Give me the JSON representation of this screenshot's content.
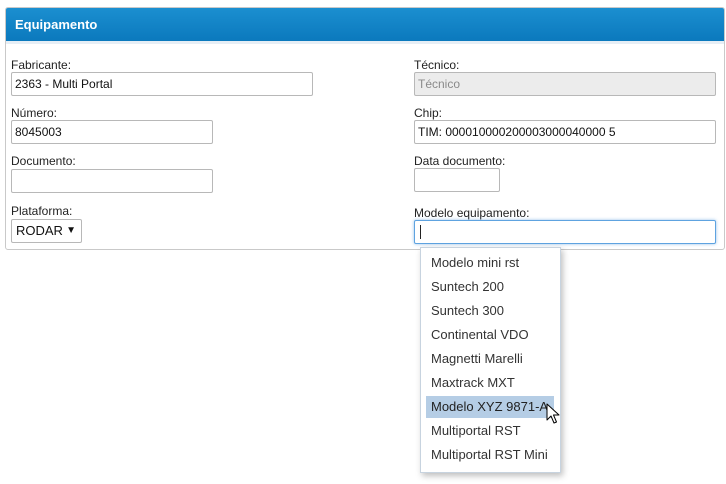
{
  "panel": {
    "title": "Equipamento"
  },
  "fields": {
    "fabricante": {
      "label": "Fabricante:",
      "value": "2363 - Multi Portal"
    },
    "numero": {
      "label": "Número:",
      "value": "8045003"
    },
    "documento": {
      "label": "Documento:",
      "value": ""
    },
    "plataforma": {
      "label": "Plataforma:",
      "value": "RODAR"
    },
    "tecnico": {
      "label": "Técnico:",
      "placeholder": "Técnico"
    },
    "chip": {
      "label": "Chip:",
      "value": "TIM: 000010000200003000040000 5"
    },
    "data_documento": {
      "label": "Data documento:",
      "value": ""
    },
    "modelo_equipamento": {
      "label": "Modelo equipamento:",
      "value": ""
    }
  },
  "dropdown": {
    "options": [
      "Modelo mini rst",
      "Suntech 200",
      "Suntech 300",
      "Continental VDO",
      "Magnetti Marelli",
      "Maxtrack MXT",
      "Modelo XYZ 9871-A",
      "Multiportal RST",
      "Multiportal RST Mini"
    ],
    "highlighted_option": "Modelo XYZ 9871-A"
  },
  "icons": {
    "select_arrow": "caret-down-icon",
    "cursor": "mouse-pointer-icon"
  }
}
